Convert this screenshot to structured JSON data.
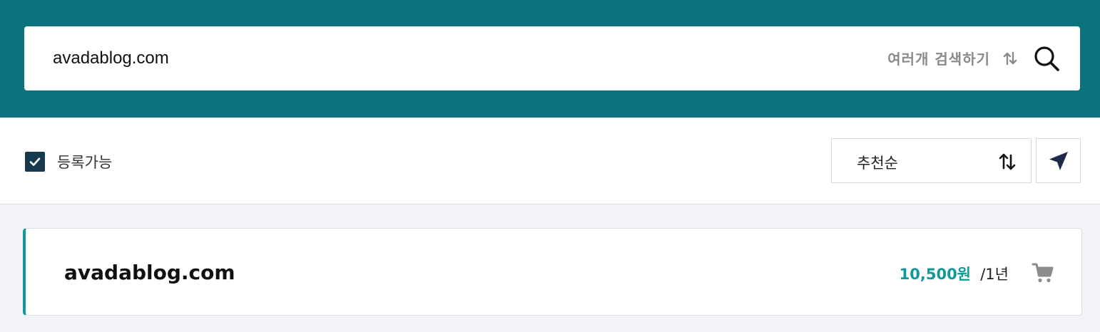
{
  "search": {
    "value": "avadablog.com",
    "multi_search_label": "여러개 검색하기",
    "icons": {
      "toggle": "sort-toggle-icon",
      "submit": "search-icon"
    }
  },
  "filters": {
    "registrable_label": "등록가능",
    "registrable_checked": true,
    "sort_label": "추천순",
    "icons": {
      "sort": "sort-arrows-icon",
      "share": "send-icon"
    }
  },
  "results": [
    {
      "domain": "avadablog.com",
      "price": "10,500원",
      "period": "/1년",
      "icon": "cart-icon"
    }
  ],
  "colors": {
    "header_bg": "#0a737e",
    "accent": "#10989a",
    "checkbox_bg": "#153a4d",
    "page_bg": "#f2f3f7"
  }
}
